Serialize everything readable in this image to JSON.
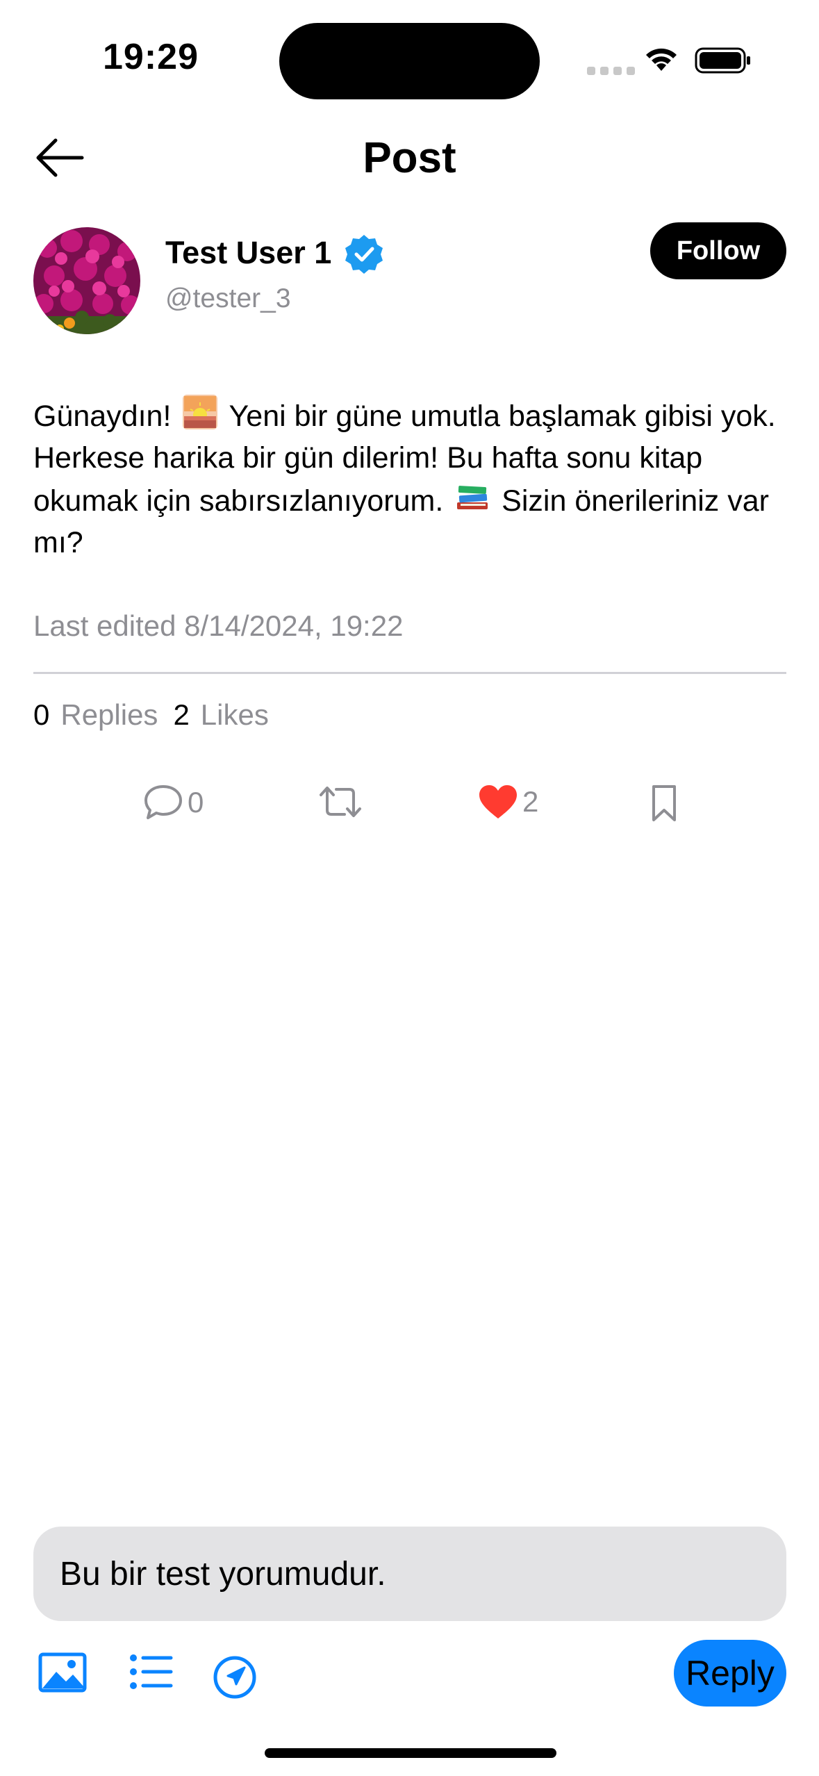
{
  "status_bar": {
    "time": "19:29"
  },
  "header": {
    "title": "Post"
  },
  "author": {
    "display_name": "Test User 1",
    "handle": "@tester_3",
    "follow_label": "Follow",
    "verified": true
  },
  "post": {
    "text_1": "Günaydın!",
    "emoji_1": "sunrise",
    "text_2": "Yeni bir güne umutla başlamak gibisi yok. Herkese harika bir gün dilerim! Bu hafta sonu kitap okumak için sabırsızlanıyorum.",
    "emoji_2": "books",
    "text_3": "Sizin önerileriniz var mı?",
    "last_edited": "Last edited 8/14/2024, 19:22"
  },
  "stats": {
    "replies_count": "0",
    "replies_label": "Replies",
    "likes_count": "2",
    "likes_label": "Likes"
  },
  "actions": {
    "comment_count": "0",
    "like_count": "2",
    "like_color": "#ff3b30"
  },
  "composer": {
    "input_value": "Bu bir test yorumudur.",
    "reply_label": "Reply",
    "accent": "#0a84ff"
  }
}
